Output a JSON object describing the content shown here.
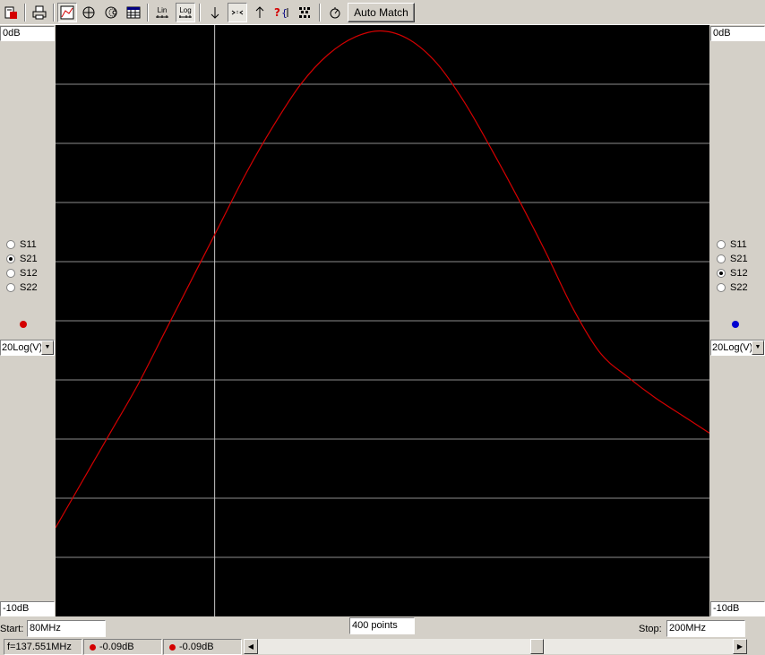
{
  "toolbar": {
    "lin_label": "Lin",
    "log_label": "Log",
    "auto_match_label": "Auto Match"
  },
  "left_panel": {
    "top_scale": "0dB",
    "bottom_scale": "-10dB",
    "params": [
      {
        "label": "S11",
        "selected": false
      },
      {
        "label": "S21",
        "selected": true
      },
      {
        "label": "S12",
        "selected": false
      },
      {
        "label": "S22",
        "selected": false
      }
    ],
    "marker_color": "#d40000",
    "format": "20Log(V)"
  },
  "right_panel": {
    "top_scale": "0dB",
    "bottom_scale": "-10dB",
    "params": [
      {
        "label": "S11",
        "selected": false
      },
      {
        "label": "S21",
        "selected": false
      },
      {
        "label": "S12",
        "selected": true
      },
      {
        "label": "S22",
        "selected": false
      }
    ],
    "marker_color": "#0000d0",
    "format": "20Log(V)"
  },
  "sweep": {
    "start_label": "Start:",
    "start_value": "80MHz",
    "points": "400 points",
    "stop_label": "Stop:",
    "stop_value": "200MHz"
  },
  "status": {
    "frequency": "f=137.551MHz",
    "marker1_value": "-0.09dB",
    "marker2_value": "-0.09dB"
  },
  "chart_data": {
    "type": "line",
    "xlim": [
      80,
      200
    ],
    "ylim": [
      -10,
      0
    ],
    "grid": true,
    "cursor_x": 109.2,
    "series": [
      {
        "color": "#d40000",
        "x": [
          80,
          85,
          90,
          95,
          100,
          105,
          110,
          115,
          120,
          125,
          130,
          135,
          140,
          145,
          150,
          155,
          160,
          165,
          170,
          175,
          180,
          185,
          190,
          195,
          200
        ],
        "y": [
          -8.5,
          -7.7,
          -6.9,
          -6.1,
          -5.2,
          -4.3,
          -3.4,
          -2.5,
          -1.7,
          -1.0,
          -0.5,
          -0.2,
          -0.1,
          -0.25,
          -0.65,
          -1.3,
          -2.1,
          -2.95,
          -3.85,
          -4.8,
          -5.55,
          -5.95,
          -6.3,
          -6.6,
          -6.9
        ]
      }
    ]
  }
}
